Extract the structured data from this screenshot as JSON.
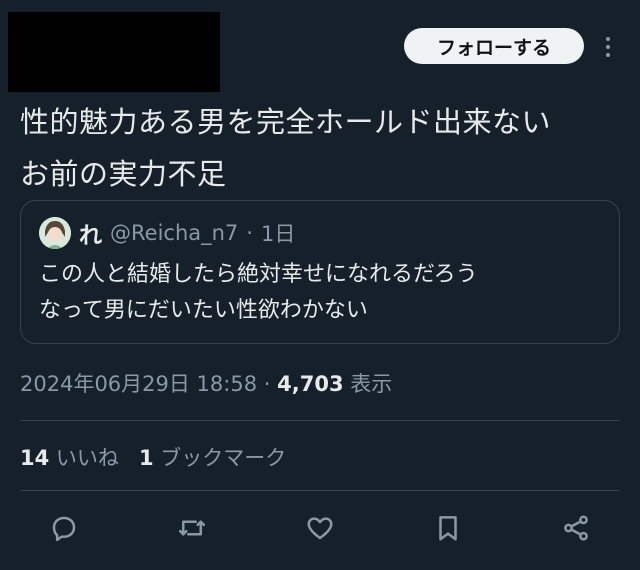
{
  "header": {
    "follow_label": "フォローする"
  },
  "tweet": {
    "text_line1": "性的魅力ある男を完全ホールド出来ない",
    "text_line2": "お前の実力不足"
  },
  "quote": {
    "name": "れ",
    "handle": "@Reicha_n7",
    "sep": "·",
    "time": "1日",
    "text_line1": "この人と結婚したら絶対幸せになれるだろう",
    "text_line2": "なって男にだいたい性欲わかない"
  },
  "meta": {
    "datetime": "2024年06月29日 18:58",
    "sep": " · ",
    "views": "4,703",
    "views_label": " 表示"
  },
  "stats": {
    "likes_count": "14",
    "likes_label": " いいね",
    "bookmarks_count": "1",
    "bookmarks_label": " ブックマーク"
  },
  "icons": [
    "reply-icon",
    "retweet-icon",
    "like-icon",
    "bookmark-icon",
    "share-icon"
  ],
  "colors": {
    "background": "#15202b",
    "text": "#e7e9ea",
    "muted": "#8b98a5",
    "border": "#38444d"
  }
}
